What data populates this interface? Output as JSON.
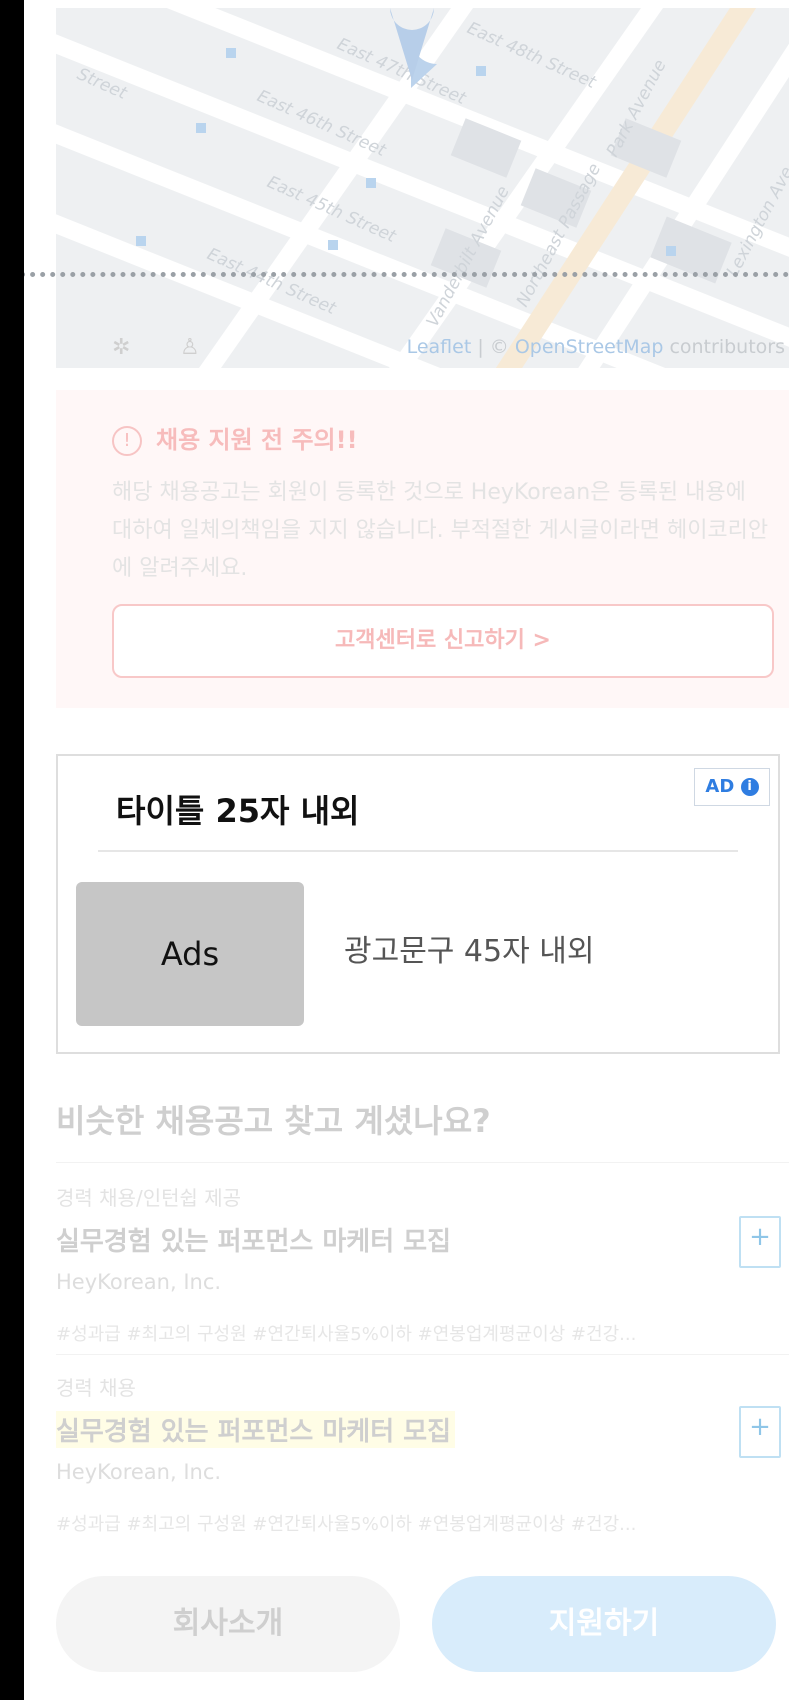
{
  "map": {
    "streets": [
      "East 47th Street",
      "East 46th Street",
      "East 45th Street",
      "East 44th Street",
      "East 48th Street",
      "Street",
      "Vanderbilt Avenue",
      "Northeast Passage",
      "Park Avenue",
      "Lexington Ave"
    ],
    "attribution": {
      "leaflet": "Leaflet",
      "separator": " | © ",
      "osm": "OpenStreetMap",
      "contributors": " contributors"
    }
  },
  "notice": {
    "title": "채용 지원 전 주의!!",
    "body": "해당 채용공고는 회원이 등록한 것으로 HeyKorean은 등록된 내용에 대하여 일체의책임을 지지 않습니다. 부적절한 게시글이라면 헤이코리안에 알려주세요.",
    "report_button": "고객센터로 신고하기 >"
  },
  "ad": {
    "badge": "AD",
    "title": "타이틀 25자 내외",
    "image_label": "Ads",
    "text": "광고문구 45자 내외"
  },
  "similar": {
    "title": "비슷한 채용공고 찾고 계셨나요?",
    "jobs": [
      {
        "category": "경력 채용/인턴쉽 제공",
        "title": "실무경험 있는 퍼포먼스 마케터 모집",
        "company": "HeyKorean, Inc.",
        "tags": "#성과급 #최고의 구성원 #연간퇴사율5%이하 #연봉업계평균이상 #건강..."
      },
      {
        "category": "경력 채용",
        "title": "실무경험 있는 퍼포먼스 마케터 모집",
        "company": "HeyKorean, Inc.",
        "tags": "#성과급 #최고의 구성원 #연간퇴사율5%이하 #연봉업계평균이상 #건강..."
      }
    ]
  },
  "bottom": {
    "company_button": "회사소개",
    "apply_button": "지원하기"
  },
  "colors": {
    "ad_badge": "#2f7de1",
    "apply_bg": "#d8ecfb",
    "highlight": "#fffde6"
  }
}
